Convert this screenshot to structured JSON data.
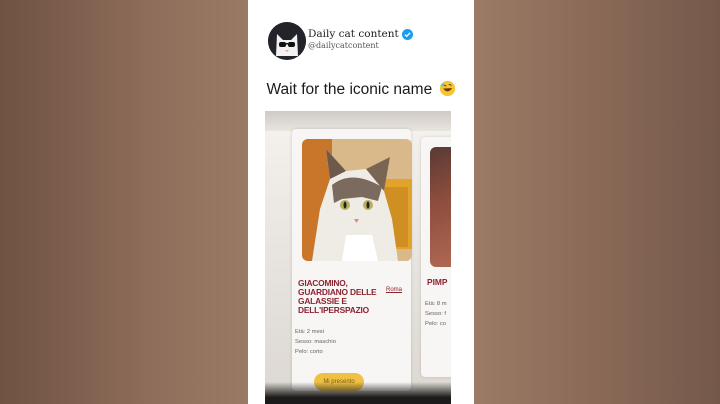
{
  "post": {
    "display_name": "Daily cat content",
    "handle": "@dailycatcontent",
    "verified_icon": "verified-badge-icon",
    "caption": "Wait for the iconic name",
    "caption_emoji": "rolling-on-floor-laughing-emoji"
  },
  "cards": [
    {
      "name": "GIACOMINO, GUARDIANO DELLE GALASSIE E DELL'IPERSPAZIO",
      "city": "Roma",
      "age": "Età: 2 mesi",
      "sex": "Sesso: maschio",
      "coat": "Pelo: corto",
      "button": "Mi presento"
    },
    {
      "name": "PIMP",
      "age": "Età: 8 m",
      "sex": "Sesso: f",
      "coat": "Pelo: co"
    }
  ],
  "colors": {
    "accent_name": "#8b2330",
    "button": "#f0c044",
    "verified": "#1d9bf0"
  }
}
